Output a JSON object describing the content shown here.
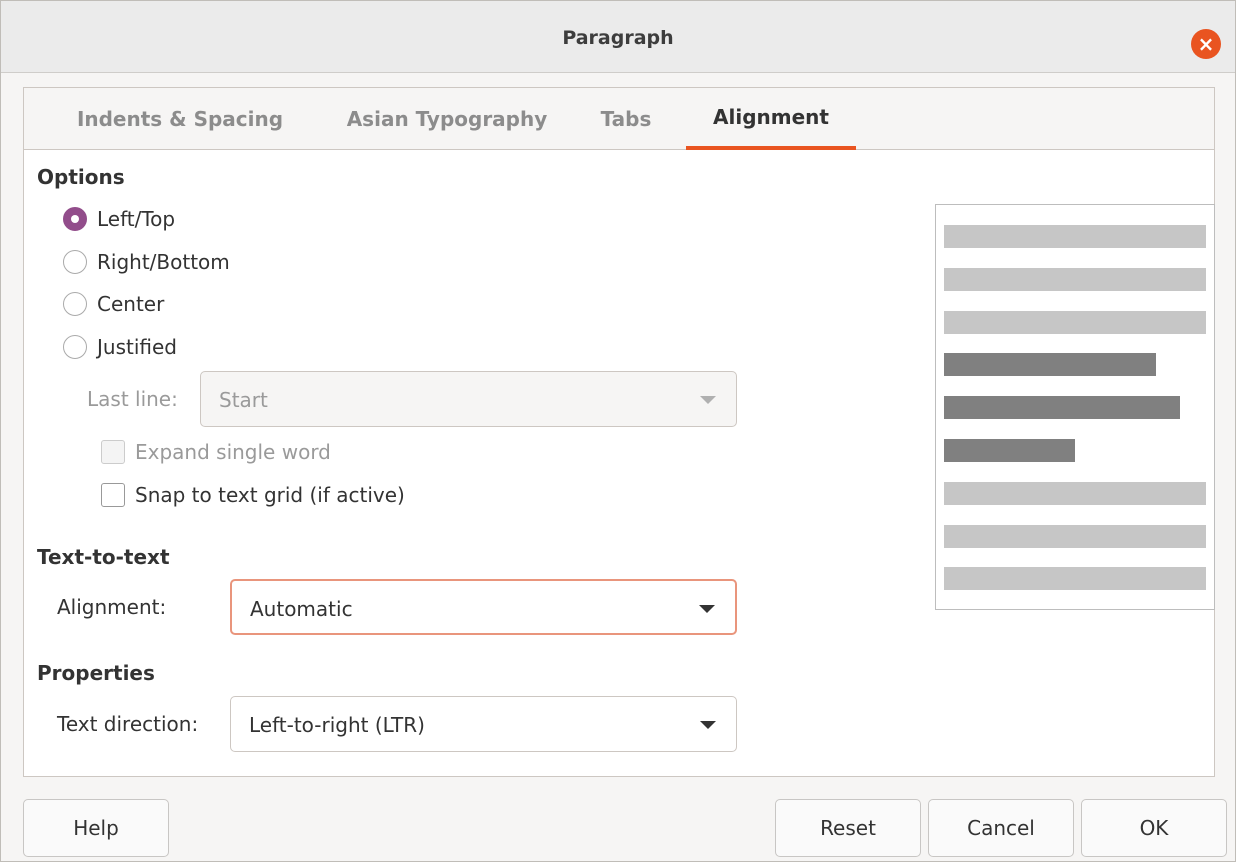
{
  "window": {
    "title": "Paragraph",
    "close_icon": "close-icon",
    "close_color": "#e95420"
  },
  "tabs": [
    {
      "label": "Indents & Spacing",
      "active": false
    },
    {
      "label": "Asian Typography",
      "active": false
    },
    {
      "label": "Tabs",
      "active": false
    },
    {
      "label": "Alignment",
      "active": true
    }
  ],
  "options": {
    "heading": "Options",
    "radios": [
      {
        "label": "Left/Top",
        "checked": true
      },
      {
        "label": "Right/Bottom",
        "checked": false
      },
      {
        "label": "Center",
        "checked": false
      },
      {
        "label": "Justified",
        "checked": false
      }
    ],
    "last_line": {
      "label": "Last line:",
      "value": "Start",
      "enabled": false
    },
    "expand_single_word": {
      "label": "Expand single word",
      "checked": false,
      "enabled": false
    },
    "snap_to_grid": {
      "label": "Snap to text grid (if active)",
      "checked": false,
      "enabled": true
    }
  },
  "text_to_text": {
    "heading": "Text-to-text",
    "alignment_label": "Alignment:",
    "alignment_value": "Automatic"
  },
  "properties": {
    "heading": "Properties",
    "direction_label": "Text direction:",
    "direction_value": "Left-to-right (LTR)"
  },
  "preview": {
    "light_color": "#c6c6c6",
    "dark_color": "#808080",
    "lines": [
      {
        "shade": "light",
        "fraction": 1.0
      },
      {
        "shade": "light",
        "fraction": 1.0
      },
      {
        "shade": "light",
        "fraction": 1.0
      },
      {
        "shade": "dark",
        "fraction": 0.81
      },
      {
        "shade": "dark",
        "fraction": 0.9
      },
      {
        "shade": "dark",
        "fraction": 0.5
      },
      {
        "shade": "light",
        "fraction": 1.0
      },
      {
        "shade": "light",
        "fraction": 1.0
      },
      {
        "shade": "light",
        "fraction": 1.0
      }
    ]
  },
  "buttons": {
    "help": "Help",
    "reset": "Reset",
    "cancel": "Cancel",
    "ok": "OK"
  },
  "accent_color": "#e95420",
  "radio_checked_color": "#924d8b"
}
